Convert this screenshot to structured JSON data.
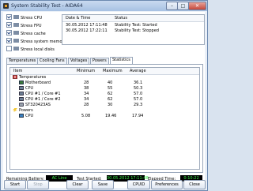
{
  "window": {
    "title": "System Stability Test - AIDA64",
    "minimize": "–",
    "maximize": "□",
    "close": "✕"
  },
  "checkboxes": [
    {
      "label": "Stress CPU",
      "checked": true
    },
    {
      "label": "Stress FPU",
      "checked": true
    },
    {
      "label": "Stress cache",
      "checked": true
    },
    {
      "label": "Stress system memory",
      "checked": true
    },
    {
      "label": "Stress local disks",
      "checked": false
    }
  ],
  "log": {
    "headers": [
      "Date & Time",
      "Status"
    ],
    "rows": [
      [
        "30.05.2012 17:11:48",
        "Stability Test: Started"
      ],
      [
        "30.05.2012 17:22:11",
        "Stability Test: Stopped"
      ]
    ]
  },
  "tabs": [
    "Temperatures",
    "Cooling Fans",
    "Voltages",
    "Powers",
    "Statistics"
  ],
  "active_tab": "Statistics",
  "stats": {
    "headers": [
      "Item",
      "Minimum",
      "Maximum",
      "Average"
    ],
    "rows": [
      {
        "label": "Temperatures",
        "min": "",
        "max": "",
        "avg": ""
      },
      {
        "label": "Motherboard",
        "min": "28",
        "max": "40",
        "avg": "36.1"
      },
      {
        "label": "CPU",
        "min": "38",
        "max": "55",
        "avg": "50.3"
      },
      {
        "label": "CPU #1 / Core #1",
        "min": "34",
        "max": "62",
        "avg": "57.0"
      },
      {
        "label": "CPU #1 / Core #2",
        "min": "34",
        "max": "62",
        "avg": "57.0"
      },
      {
        "label": "ST320423AS",
        "min": "28",
        "max": "30",
        "avg": "29.3"
      },
      {
        "label": "Powers",
        "min": "",
        "max": "",
        "avg": ""
      },
      {
        "label": "CPU",
        "min": "5.08",
        "max": "19.46",
        "avg": "17.94"
      }
    ]
  },
  "status_bar": {
    "battery_label": "Remaining Battery:",
    "battery_value": "AC Line",
    "started_label": "Test Started:",
    "started_value": "30.05.2012 17:11:48",
    "elapsed_label": "Elapsed Time:",
    "elapsed_value": "0:10:22"
  },
  "buttons": {
    "start": "Start",
    "stop": "Stop",
    "clear": "Clear",
    "save": "Save",
    "cpuid": "CPUID",
    "preferences": "Preferences",
    "close": "Close"
  }
}
